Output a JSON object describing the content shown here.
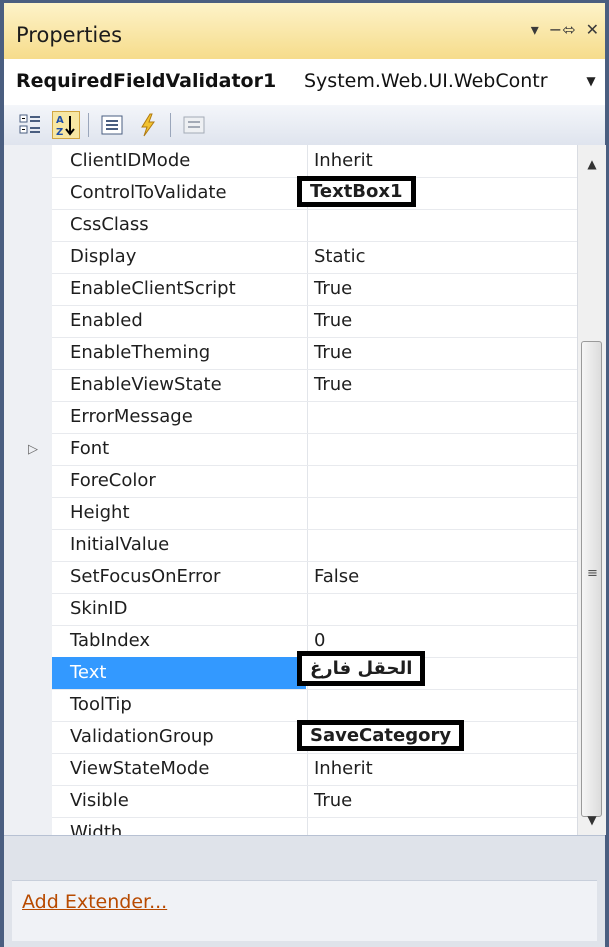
{
  "window": {
    "title": "Properties",
    "controls": [
      "▾",
      "−⬄",
      "✕"
    ]
  },
  "object_selector": {
    "name": "RequiredFieldValidator1",
    "type": "System.Web.UI.WebContr",
    "dropdown_icon": "dropdown-arrow-icon"
  },
  "toolbar": {
    "buttons": [
      {
        "name": "categorized-icon",
        "active": false
      },
      {
        "name": "alphabetical-icon",
        "active": true
      },
      {
        "name": "properties-icon",
        "active": false
      },
      {
        "name": "events-icon",
        "active": false
      },
      {
        "name": "property-pages-icon",
        "active": false
      }
    ]
  },
  "properties": [
    {
      "name": "ClientIDMode",
      "value": "Inherit"
    },
    {
      "name": "ControlToValidate",
      "value": "TextBox1"
    },
    {
      "name": "CssClass",
      "value": ""
    },
    {
      "name": "Display",
      "value": "Static"
    },
    {
      "name": "EnableClientScript",
      "value": "True"
    },
    {
      "name": "Enabled",
      "value": "True"
    },
    {
      "name": "EnableTheming",
      "value": "True"
    },
    {
      "name": "EnableViewState",
      "value": "True"
    },
    {
      "name": "ErrorMessage",
      "value": ""
    },
    {
      "name": "Font",
      "value": ""
    },
    {
      "name": "ForeColor",
      "value": ""
    },
    {
      "name": "Height",
      "value": ""
    },
    {
      "name": "InitialValue",
      "value": ""
    },
    {
      "name": "SetFocusOnError",
      "value": "False"
    },
    {
      "name": "SkinID",
      "value": ""
    },
    {
      "name": "TabIndex",
      "value": "0"
    },
    {
      "name": "Text",
      "value": "الحقل فارغ"
    },
    {
      "name": "ToolTip",
      "value": ""
    },
    {
      "name": "ValidationGroup",
      "value": "SaveCategory"
    },
    {
      "name": "ViewStateMode",
      "value": "Inherit"
    },
    {
      "name": "Visible",
      "value": "True"
    },
    {
      "name": "Width",
      "value": ""
    }
  ],
  "commands": {
    "add_extender": "Add Extender..."
  },
  "colors": {
    "selection": "#3399ff",
    "title_bar": "#f6dc8b",
    "link": "#b84a00"
  }
}
